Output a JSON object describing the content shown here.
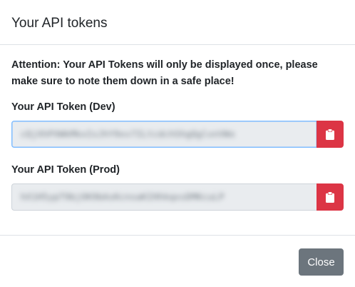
{
  "modal": {
    "title": "Your API tokens",
    "attention": "Attention: Your API Tokens will only be displayed once, please make sure to note them down in a safe place!",
    "tokens": [
      {
        "label": "Your API Token (Dev)",
        "value": "cQjXhPXWkMkxIsJhY9xv7ILtcdchShgQglxnVWx"
      },
      {
        "label": "Your API Token (Prod)",
        "value": "hX1H5ypT9bjOK9bAsKcnsaKIHhkqxsDMKcuLP"
      }
    ],
    "close_label": "Close"
  },
  "colors": {
    "copy_button": "#dc3545",
    "close_button": "#6c757d",
    "input_background": "#e9ecef",
    "focus_border": "#80bdff"
  },
  "icons": {
    "copy": "clipboard-icon"
  }
}
